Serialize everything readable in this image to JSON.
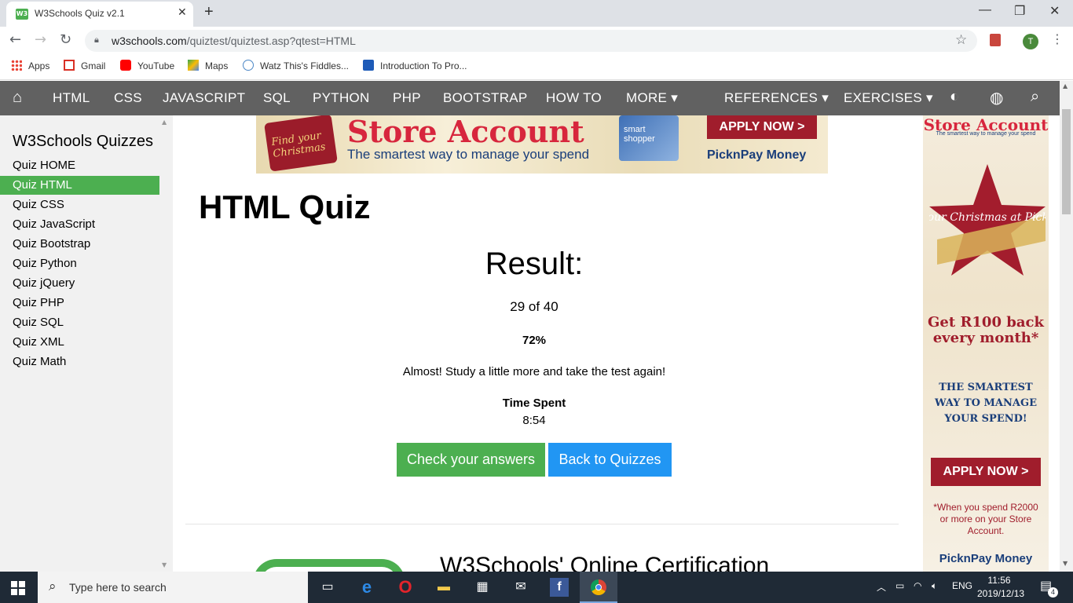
{
  "browser": {
    "tab_title": "W3Schools Quiz v2.1",
    "tab_favicon": "W3",
    "new_tab_label": "+",
    "url_domain": "w3schools.com",
    "url_path": "/quiztest/quiztest.asp?qtest=HTML",
    "avatar_letter": "T",
    "bookmarks": [
      "Apps",
      "Gmail",
      "YouTube",
      "Maps",
      "Watz This's Fiddles...",
      "Introduction To Pro..."
    ]
  },
  "navbar": {
    "items": [
      "HTML",
      "CSS",
      "JAVASCRIPT",
      "SQL",
      "PYTHON",
      "PHP",
      "BOOTSTRAP",
      "HOW TO",
      "MORE ▾",
      "REFERENCES ▾",
      "EXERCISES ▾"
    ]
  },
  "sidebar": {
    "title": "W3Schools Quizzes",
    "items": [
      "Quiz HOME",
      "Quiz HTML",
      "Quiz CSS",
      "Quiz JavaScript",
      "Quiz Bootstrap",
      "Quiz Python",
      "Quiz jQuery",
      "Quiz PHP",
      "Quiz SQL",
      "Quiz XML",
      "Quiz Math"
    ],
    "active_item": "Quiz HTML"
  },
  "banner_ad": {
    "badge": "Find your Christmas",
    "headline": "Store Account",
    "subline": "The smartest way to manage your spend",
    "card_text": "smart shopper",
    "cta": "APPLY NOW >",
    "logo": "PicknPay Money"
  },
  "main": {
    "title": "HTML Quiz",
    "result_label": "Result:",
    "score": "29 of 40",
    "percent": "72%",
    "message": "Almost! Study a little more and take the test again!",
    "time_label": "Time Spent",
    "time_value": "8:54",
    "check_button": "Check your answers",
    "back_button": "Back to Quizzes",
    "cert_heading": "W3Schools' Online Certification"
  },
  "side_ad": {
    "headline": "Store Account",
    "subline": "The smartest way to manage your spend",
    "star_text": "Find your Christmas at Pick n Pay",
    "offer": "Get R100 back every month*",
    "tagline": "THE SMARTEST WAY TO MANAGE YOUR SPEND!",
    "cta": "APPLY NOW >",
    "note": "*When you spend R2000 or more on your Store Account.",
    "logo": "PicknPay Money"
  },
  "taskbar": {
    "search_placeholder": "Type here to search",
    "language": "ENG",
    "time": "11:56",
    "date": "2019/12/13",
    "notification_count": "4"
  },
  "colors": {
    "w3_green": "#4CAF50",
    "w3_blue": "#2196F3",
    "navbar_gray": "#616161",
    "ad_red": "#d7263d"
  }
}
